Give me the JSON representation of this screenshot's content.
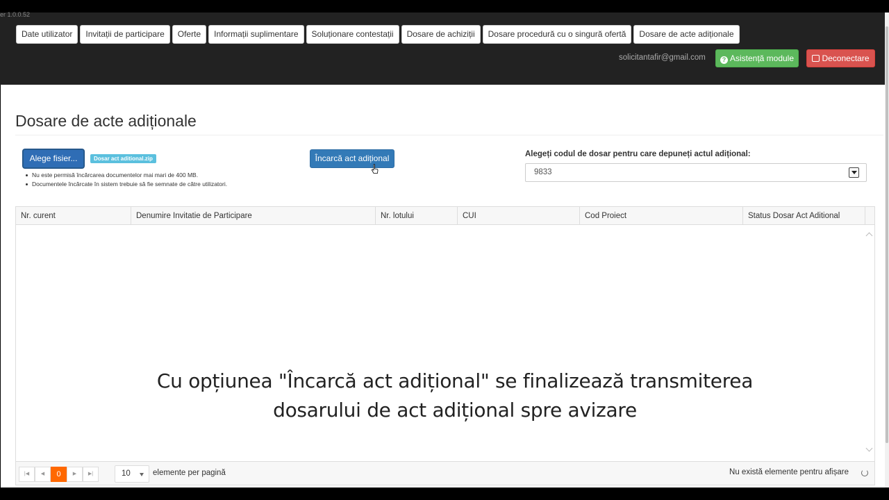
{
  "app": {
    "version": "er 1.0.0.52"
  },
  "nav": {
    "tabs": [
      "Date utilizator",
      "Invitații de participare",
      "Oferte",
      "Informații suplimentare",
      "Soluționare contestații",
      "Dosare de achiziții",
      "Dosare procedură cu o singură ofertă",
      "Dosare de acte adiționale"
    ]
  },
  "header": {
    "user_email": "solicitantafir@gmail.com",
    "help_label": "Asistență module",
    "logout_label": "Deconectare"
  },
  "page": {
    "title": "Dosare de acte adiționale"
  },
  "upload": {
    "choose_label": "Alege fisier...",
    "file_name": "Dosar act aditional.zip",
    "notes": [
      "Nu este permisă încărcarea documentelor mai mari de 400 MB.",
      "Documentele încărcate în sistem trebuie să fie semnate de către utilizatori."
    ],
    "upload_label": "Încarcă act adițional"
  },
  "dosar_select": {
    "label": "Alegeți codul de dosar pentru care depuneți actul adițional:",
    "value": "9833"
  },
  "grid": {
    "columns": [
      "Nr. curent",
      "Denumire Invitatie de Participare",
      "Nr. lotului",
      "CUI",
      "Cod Proiect",
      "Status Dosar Act Aditional"
    ],
    "rows": []
  },
  "pager": {
    "current_page": "0",
    "page_size": "10",
    "per_page_label": "elemente per pagină",
    "empty_message": "Nu există elemente pentru afișare"
  },
  "caption": {
    "line1": "Cu opțiunea \"Încarcă act adițional\" se finalizează transmiterea",
    "line2": "dosarului de act adițional spre avizare"
  }
}
